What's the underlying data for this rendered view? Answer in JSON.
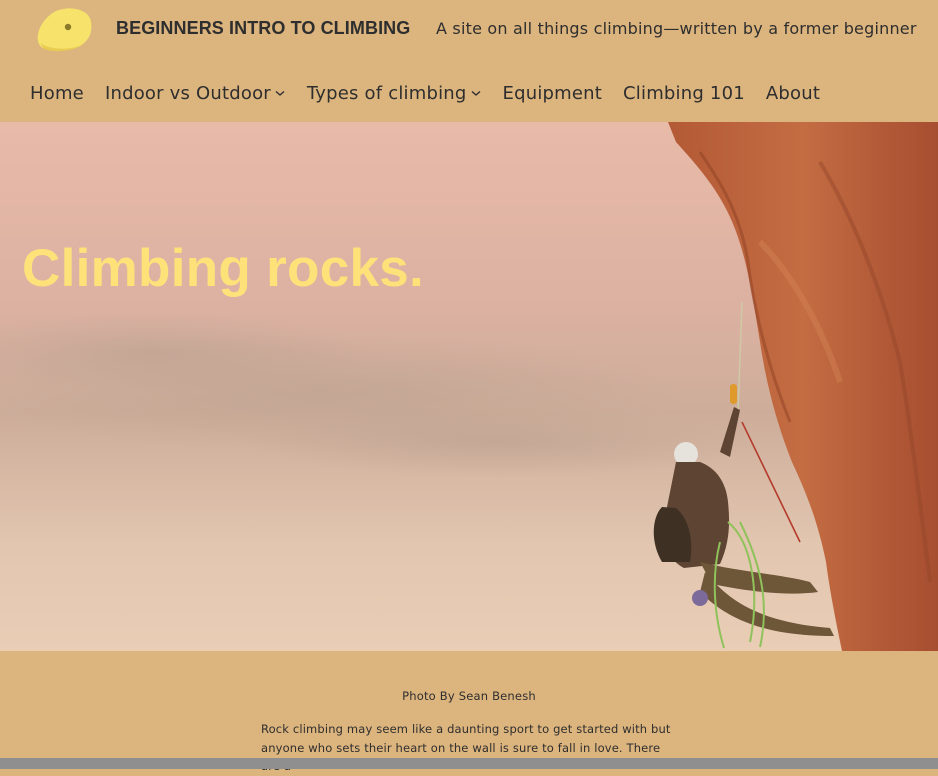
{
  "site": {
    "title": "BEGINNERS INTRO TO CLIMBING",
    "tagline": "A site on all things climbing—written by a former beginner",
    "logo_icon": "climbing-hold-icon",
    "colors": {
      "background": "#dcb47e",
      "hero_title": "#fde27a",
      "text": "#2e2e2e"
    }
  },
  "nav": {
    "items": [
      {
        "label": "Home",
        "has_dropdown": false
      },
      {
        "label": "Indoor vs Outdoor",
        "has_dropdown": true
      },
      {
        "label": "Types of climbing",
        "has_dropdown": true
      },
      {
        "label": "Equipment",
        "has_dropdown": false
      },
      {
        "label": "Climbing 101",
        "has_dropdown": false
      },
      {
        "label": "About",
        "has_dropdown": false
      }
    ]
  },
  "hero": {
    "title": "Climbing rocks.",
    "caption": "Photo By Sean Benesh"
  },
  "content": {
    "intro_line1": "Rock climbing may seem like a daunting sport to get started with but",
    "intro_line2": "anyone who sets their heart on the wall is sure to fall in love. There are a"
  }
}
